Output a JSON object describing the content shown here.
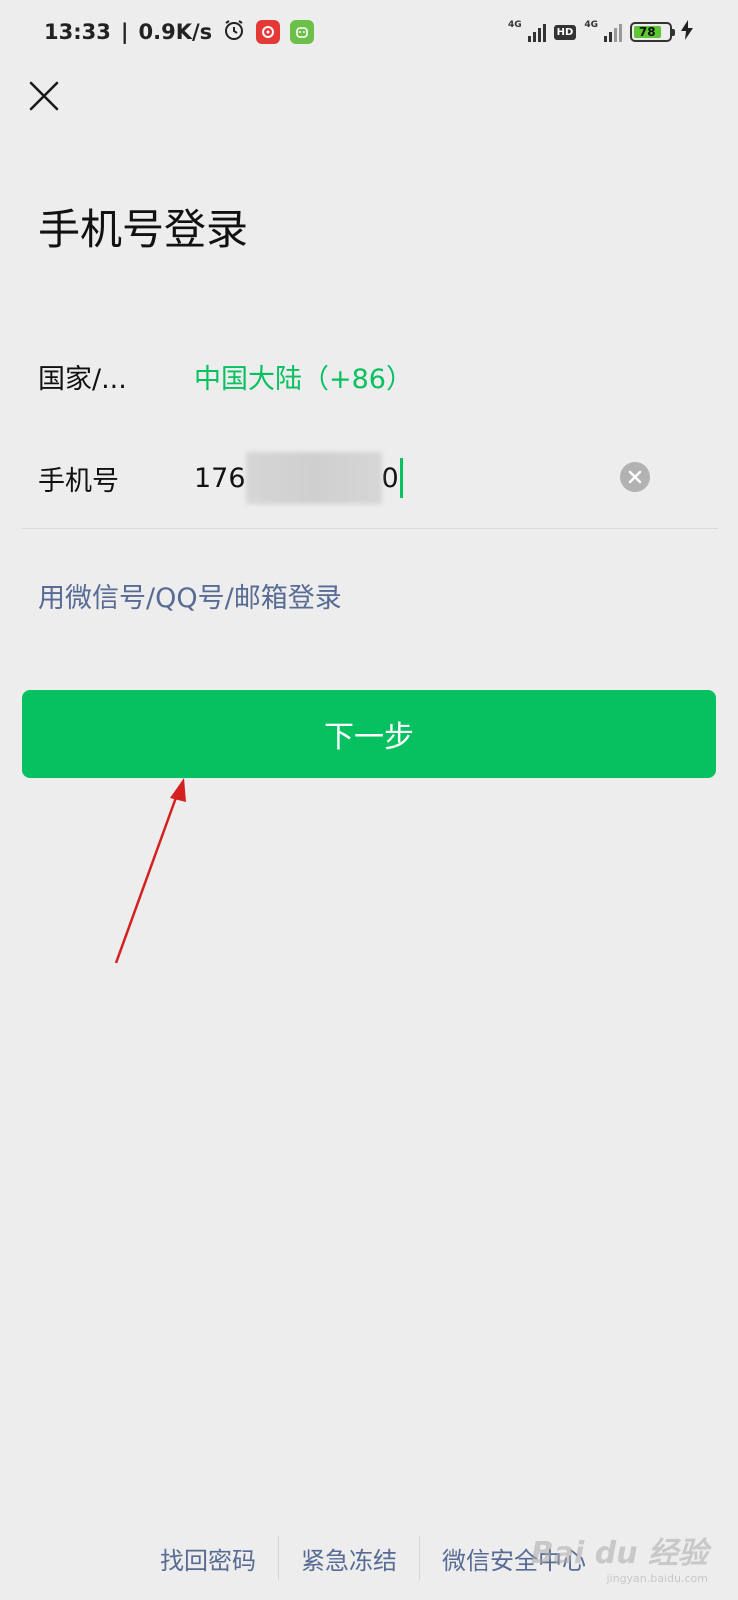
{
  "status_bar": {
    "time": "13:33",
    "net_speed": "0.9K/s",
    "network_type_1": "4G",
    "network_type_2": "4G",
    "hd_label": "HD",
    "battery_level": "78",
    "icons": [
      "alarm-icon",
      "netease-music-icon",
      "app-badge-icon",
      "signal-icon",
      "hd-icon",
      "battery-icon",
      "charging-icon"
    ]
  },
  "header": {
    "close_icon": "close-icon",
    "title": "手机号登录"
  },
  "form": {
    "country_label": "国家/...",
    "country_value": "中国大陆（+86）",
    "phone_label": "手机号",
    "phone_prefix": "176",
    "phone_suffix": "0",
    "clear_icon": "clear-icon"
  },
  "alt_login_link": "用微信号/QQ号/邮箱登录",
  "next_button": "下一步",
  "footer": {
    "links": [
      "找回密码",
      "紧急冻结",
      "微信安全中心"
    ]
  },
  "watermark": {
    "main": "Bai du 经验",
    "sub": "jingyan.baidu.com"
  },
  "colors": {
    "accent": "#07c160",
    "link": "#576b95",
    "background": "#ededed",
    "annotation_arrow": "#d42020"
  }
}
